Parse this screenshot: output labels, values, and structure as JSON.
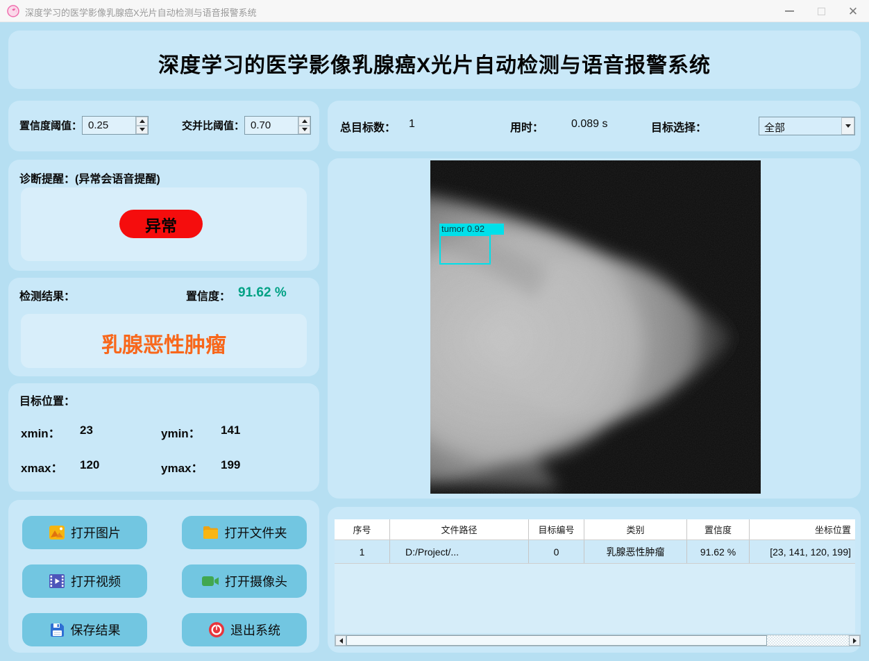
{
  "window": {
    "title": "深度学习的医学影像乳腺癌X光片自动检测与语音报警系统",
    "minimize": "",
    "maximize": "",
    "close": "✕"
  },
  "header": {
    "title": "深度学习的医学影像乳腺癌X光片自动检测与语音报警系统"
  },
  "thresholds": {
    "conf_label": "置信度阈值：",
    "conf_value": "0.25",
    "iou_label": "交并比阈值：",
    "iou_value": "0.70"
  },
  "stats": {
    "total_label": "总目标数：",
    "total_value": "1",
    "time_label": "用时：",
    "time_value": "0.089 s",
    "select_label": "目标选择：",
    "select_value": "全部"
  },
  "diagnosis": {
    "label": "诊断提醒：(异常会语音提醒)",
    "status": "异常",
    "status_color": "#f50d0d"
  },
  "result": {
    "label": "检测结果：",
    "conf_label": "置信度：",
    "conf_value": "91.62 %",
    "conf_color": "#00a184",
    "class_name": "乳腺恶性肿瘤",
    "class_color": "#f8671b"
  },
  "position": {
    "label": "目标位置：",
    "xmin_label": "xmin：",
    "xmin_value": "23",
    "ymin_label": "ymin：",
    "ymin_value": "141",
    "xmax_label": "xmax：",
    "xmax_value": "120",
    "ymax_label": "ymax：",
    "ymax_value": "199"
  },
  "buttons": {
    "open_image": "打开图片",
    "open_folder": "打开文件夹",
    "open_video": "打开视频",
    "open_camera": "打开摄像头",
    "save_result": "保存结果",
    "exit_system": "退出系统"
  },
  "viewer": {
    "detection_label": "tumor 0.92",
    "box_color": "#00e0ea"
  },
  "table": {
    "headers": [
      "序号",
      "文件路径",
      "目标编号",
      "类别",
      "置信度",
      "坐标位置"
    ],
    "rows": [
      [
        "1",
        "D:/Project/...",
        "0",
        "乳腺恶性肿瘤",
        "91.62 %",
        "[23, 141, 120, 199]"
      ]
    ]
  }
}
